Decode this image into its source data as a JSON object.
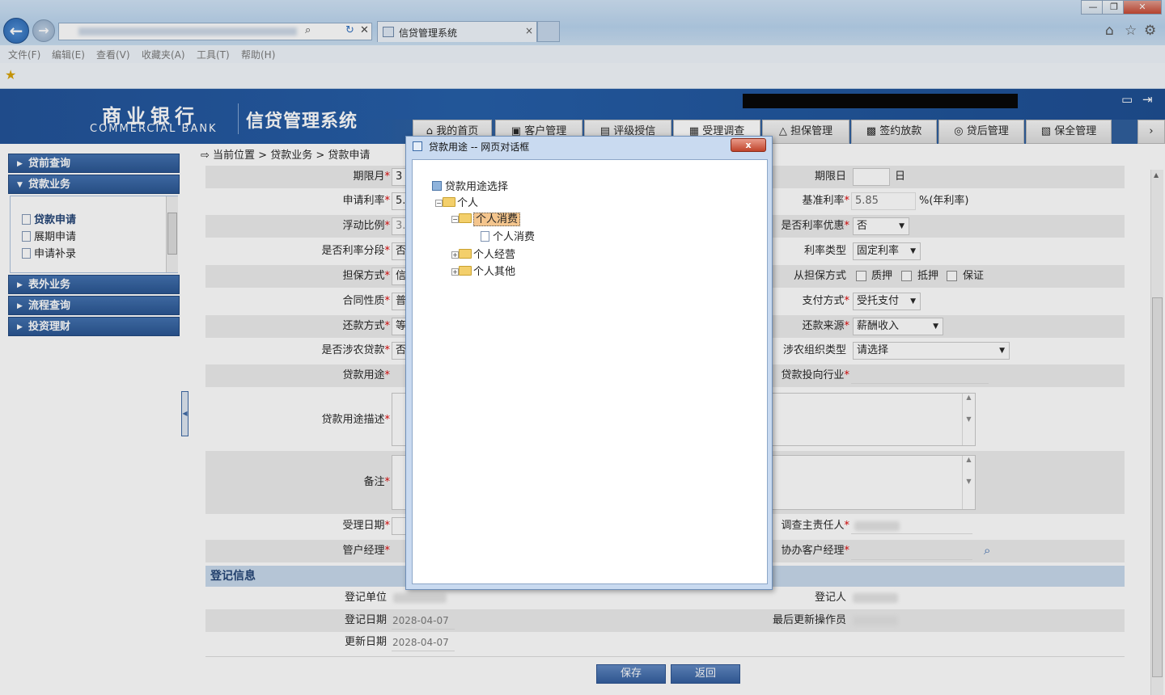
{
  "browser": {
    "tab_title": "信贷管理系统",
    "menu": [
      "文件(F)",
      "编辑(E)",
      "查看(V)",
      "收藏夹(A)",
      "工具(T)",
      "帮助(H)"
    ]
  },
  "header": {
    "bank_cn": "商业银行",
    "bank_en": "COMMERCIAL BANK",
    "system_name": "信贷管理系统",
    "tabs": [
      "我的首页",
      "客户管理",
      "评级授信",
      "受理调查",
      "担保管理",
      "签约放款",
      "贷后管理",
      "保全管理"
    ]
  },
  "sidebar": {
    "sections": [
      "贷前查询",
      "贷款业务",
      "表外业务",
      "流程查询",
      "投资理财"
    ],
    "items": [
      "贷款申请",
      "展期申请",
      "申请补录"
    ]
  },
  "breadcrumb": "当前位置 > 贷款业务 > 贷款申请",
  "form": {
    "term_month_label": "期限月",
    "term_month_value": "3",
    "term_day_label": "期限日",
    "term_day_unit": "日",
    "apply_rate_label": "申请利率",
    "apply_rate_value": "5.",
    "base_rate_label": "基准利率",
    "base_rate_value": "5.85",
    "base_rate_unit": "%(年利率)",
    "float_ratio_label": "浮动比例",
    "float_ratio_value": "3.",
    "rate_discount_label": "是否利率优惠",
    "rate_discount_value": "否",
    "rate_segment_label": "是否利率分段",
    "rate_segment_value": "否",
    "rate_type_label": "利率类型",
    "rate_type_value": "固定利率",
    "guarantee_label": "担保方式",
    "guarantee_value": "信",
    "sub_guarantee_label": "从担保方式",
    "sub_guarantee_options": [
      "质押",
      "抵押",
      "保证"
    ],
    "contract_label": "合同性质",
    "contract_value": "普",
    "payment_label": "支付方式",
    "payment_value": "受托支付",
    "repay_label": "还款方式",
    "repay_value": "等",
    "repay_source_label": "还款来源",
    "repay_source_value": "薪酬收入",
    "agri_label": "是否涉农贷款",
    "agri_value": "否",
    "agri_org_label": "涉农组织类型",
    "agri_org_value": "请选择",
    "purpose_label": "贷款用途",
    "industry_label": "贷款投向行业",
    "purpose_desc_label": "贷款用途描述",
    "remark_label": "备注",
    "accept_date_label": "受理日期",
    "investigator_label": "调查主责任人",
    "manager_label": "管户经理",
    "assist_manager_label": "协办客户经理"
  },
  "register": {
    "title": "登记信息",
    "unit_label": "登记单位",
    "person_label": "登记人",
    "date_label": "登记日期",
    "date_value": "2028-04-07",
    "last_op_label": "最后更新操作员",
    "update_label": "更新日期",
    "update_value": "2028-04-07"
  },
  "buttons": {
    "save": "保存",
    "back": "返回"
  },
  "dialog": {
    "title": "贷款用途 -- 网页对话框",
    "close": "x",
    "tree_root": "贷款用途选择",
    "node_personal": "个人",
    "node_consume": "个人消费",
    "leaf_consume": "个人消费",
    "node_business": "个人经营",
    "node_other": "个人其他"
  }
}
